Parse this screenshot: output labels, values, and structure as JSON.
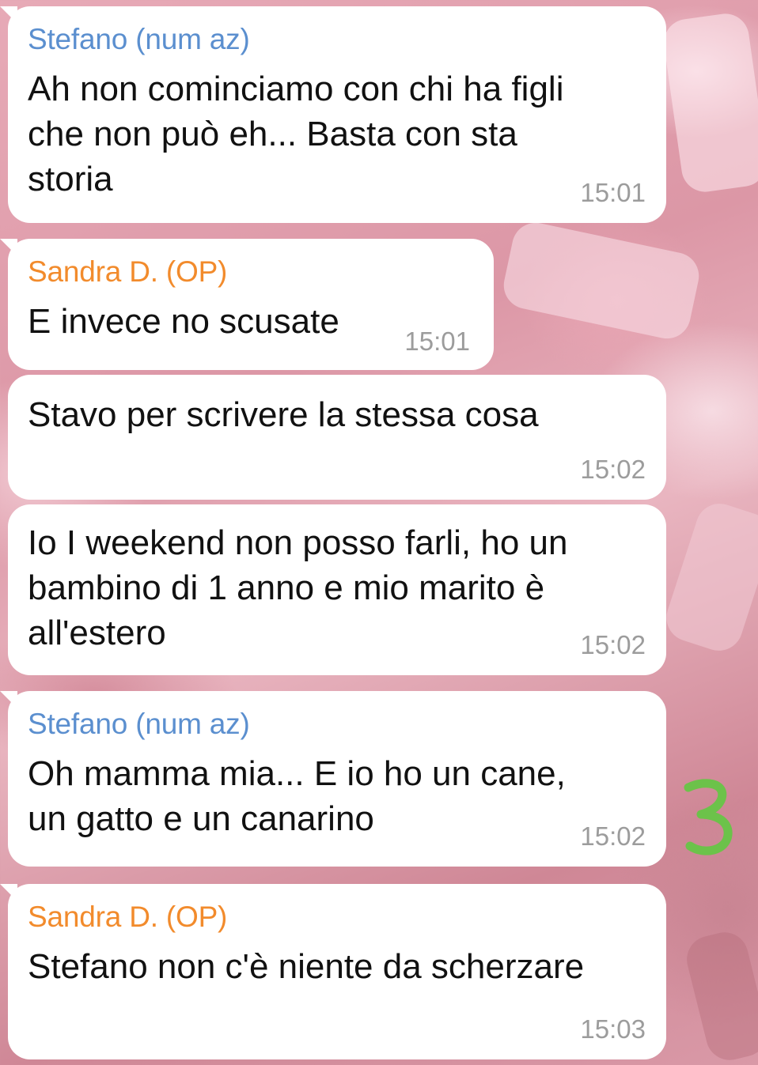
{
  "messages": [
    {
      "sender": "Stefano (num az)",
      "sender_color": "#5b8fcf",
      "text": "Ah non cominciamo con chi ha figli\nche non può eh... Basta con sta\nstoria",
      "time": "15:01"
    },
    {
      "sender": "Sandra D. (OP)",
      "sender_color": "#f28b2c",
      "text": "E invece no scusate",
      "time": "15:01"
    },
    {
      "sender": "",
      "text": "Stavo per scrivere la stessa cosa",
      "time": "15:02"
    },
    {
      "sender": "",
      "text": "Io I weekend non posso farli, ho un\nbambino di 1 anno e mio marito è\nall'estero",
      "time": "15:02"
    },
    {
      "sender": "Stefano (num az)",
      "sender_color": "#5b8fcf",
      "text": "Oh mamma mia... E io ho un cane,\nun gatto e un canarino",
      "time": "15:02"
    },
    {
      "sender": "Sandra D. (OP)",
      "sender_color": "#f28b2c",
      "text": "Stefano non c'è niente da scherzare",
      "time": "15:03"
    }
  ],
  "annotation": {
    "label": "3",
    "color": "#6cc24a"
  }
}
